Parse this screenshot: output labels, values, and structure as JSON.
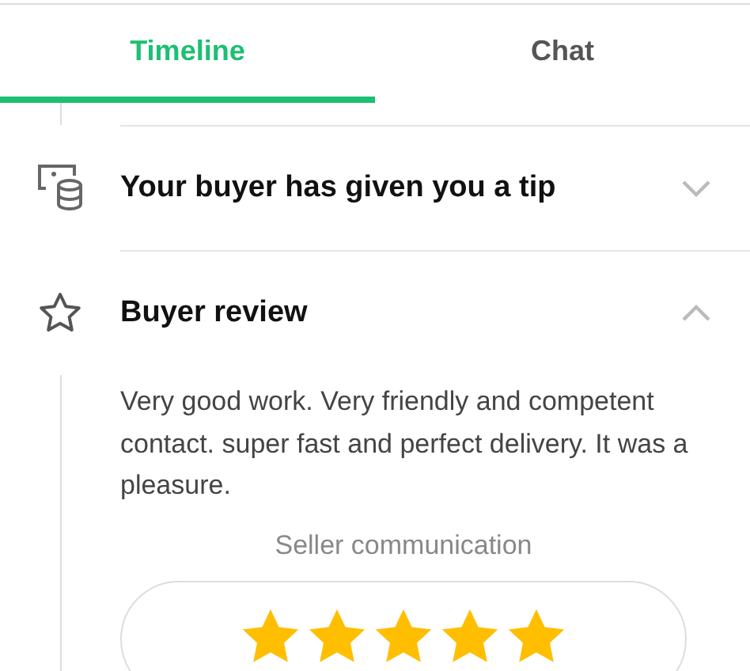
{
  "tabs": [
    {
      "label": "Timeline",
      "selected": true
    },
    {
      "label": "Chat",
      "selected": false
    }
  ],
  "timeline": [
    {
      "kind": "tip",
      "title": "Your buyer has given you a tip",
      "expanded": false
    },
    {
      "kind": "review",
      "title": "Buyer review",
      "expanded": true,
      "text": "Very good work. Very friendly and competent contact. super fast and perfect delivery. It was a pleasure.",
      "rating": {
        "label": "Seller communication",
        "stars": 5
      }
    }
  ]
}
